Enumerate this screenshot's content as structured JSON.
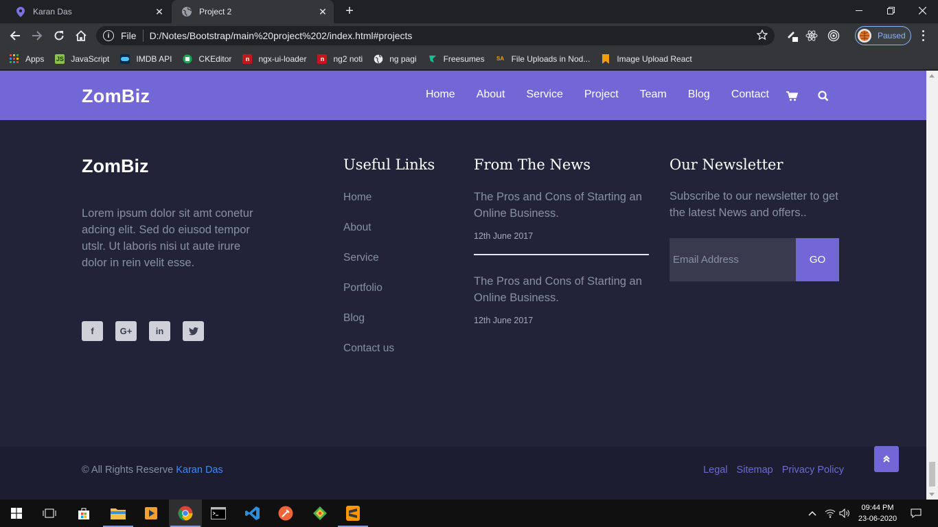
{
  "browser": {
    "tabs": [
      {
        "title": "Karan Das",
        "active": false
      },
      {
        "title": "Project 2",
        "active": true
      }
    ],
    "scheme_label": "File",
    "url": "D:/Notes/Bootstrap/main%20project%202/index.html#projects",
    "profile_status": "Paused",
    "bookmarks": [
      {
        "label": "Apps",
        "icon": "apps-grid-icon",
        "color": "#e8453c"
      },
      {
        "label": "JavaScript",
        "icon": "javascript-icon",
        "color": "#8bc34a"
      },
      {
        "label": "IMDB API",
        "icon": "imdb-api-icon",
        "color": "#0a4a7a"
      },
      {
        "label": "CKEditor",
        "icon": "ckeditor-icon",
        "color": "#1aaa55"
      },
      {
        "label": "ngx-ui-loader",
        "icon": "ngx-ui-loader-icon",
        "color": "#c4161c"
      },
      {
        "label": "ng2 noti",
        "icon": "ng2-noti-icon",
        "color": "#c4161c"
      },
      {
        "label": "ng pagi",
        "icon": "globe-icon",
        "color": "#e8eaed"
      },
      {
        "label": "Freesumes",
        "icon": "freesumes-icon",
        "color": "#1abc9c"
      },
      {
        "label": "File Uploads in Nod...",
        "icon": "sa-icon",
        "color": "#f39c12"
      },
      {
        "label": "Image Upload React",
        "icon": "bookmark-ribbon-icon",
        "color": "#f39c12"
      }
    ]
  },
  "site": {
    "brand": "ZomBiz",
    "nav": [
      "Home",
      "About",
      "Service",
      "Project",
      "Team",
      "Blog",
      "Contact"
    ],
    "accent_color": "#7367d8",
    "footer": {
      "brand": "ZomBiz",
      "about": "Lorem ipsum dolor sit amt conetur adcing elit. Sed do eiusod tempor utslr. Ut laboris nisi ut aute irure dolor in rein velit esse.",
      "socials": [
        "facebook-icon",
        "google-plus-icon",
        "linkedin-icon",
        "twitter-icon"
      ],
      "useful_links_title": "Useful Links",
      "useful_links": [
        "Home",
        "About",
        "Service",
        "Portfolio",
        "Blog",
        "Contact us"
      ],
      "news_title": "From The News",
      "news": [
        {
          "title": "The Pros and Cons of Starting an Online Business.",
          "date": "12th June 2017"
        },
        {
          "title": "The Pros and Cons of Starting an Online Business.",
          "date": "12th June 2017"
        }
      ],
      "newsletter_title": "Our Newsletter",
      "newsletter_text": "Subscribe to our newsletter to get the latest News and offers..",
      "email_placeholder": "Email Address",
      "go_label": "GO",
      "copyright_prefix": "© All Rights Reserve",
      "copyright_author": "Karan Das",
      "legal_links": [
        "Legal",
        "Sitemap",
        "Privacy Policy"
      ]
    }
  },
  "taskbar": {
    "time": "09:44 PM",
    "date": "23-06-2020"
  }
}
